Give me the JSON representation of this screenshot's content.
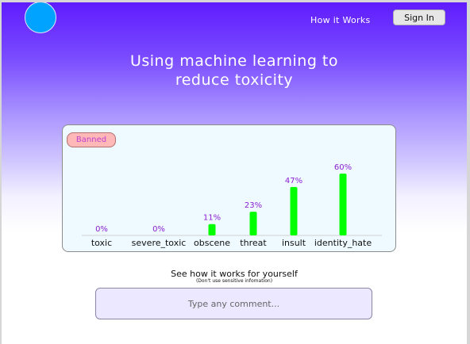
{
  "nav": {
    "how_it_works": "How it Works",
    "sign_in": "Sign In"
  },
  "hero": {
    "line1": "Using machine learning to",
    "line2": "reduce toxicity"
  },
  "result": {
    "badge": "Banned",
    "badge_color": "#ffb8b8"
  },
  "colors": {
    "bar": "#00ff00",
    "percent_label": "#8a1fd0",
    "logo": "#00a3ff"
  },
  "chart_data": {
    "type": "bar",
    "categories": [
      "toxic",
      "severe_toxic",
      "obscene",
      "threat",
      "insult",
      "identity_hate"
    ],
    "values": [
      0,
      0,
      11,
      23,
      47,
      60
    ],
    "value_labels": [
      "0%",
      "0%",
      "11%",
      "23%",
      "47%",
      "60%"
    ],
    "ylim": [
      0,
      100
    ],
    "grid": false,
    "title": "",
    "xlabel": "",
    "ylabel": ""
  },
  "try_it": {
    "title": "See how it works for yourself",
    "subtitle": "(Don't use sensitive infomation)",
    "placeholder": "Type any comment..."
  }
}
